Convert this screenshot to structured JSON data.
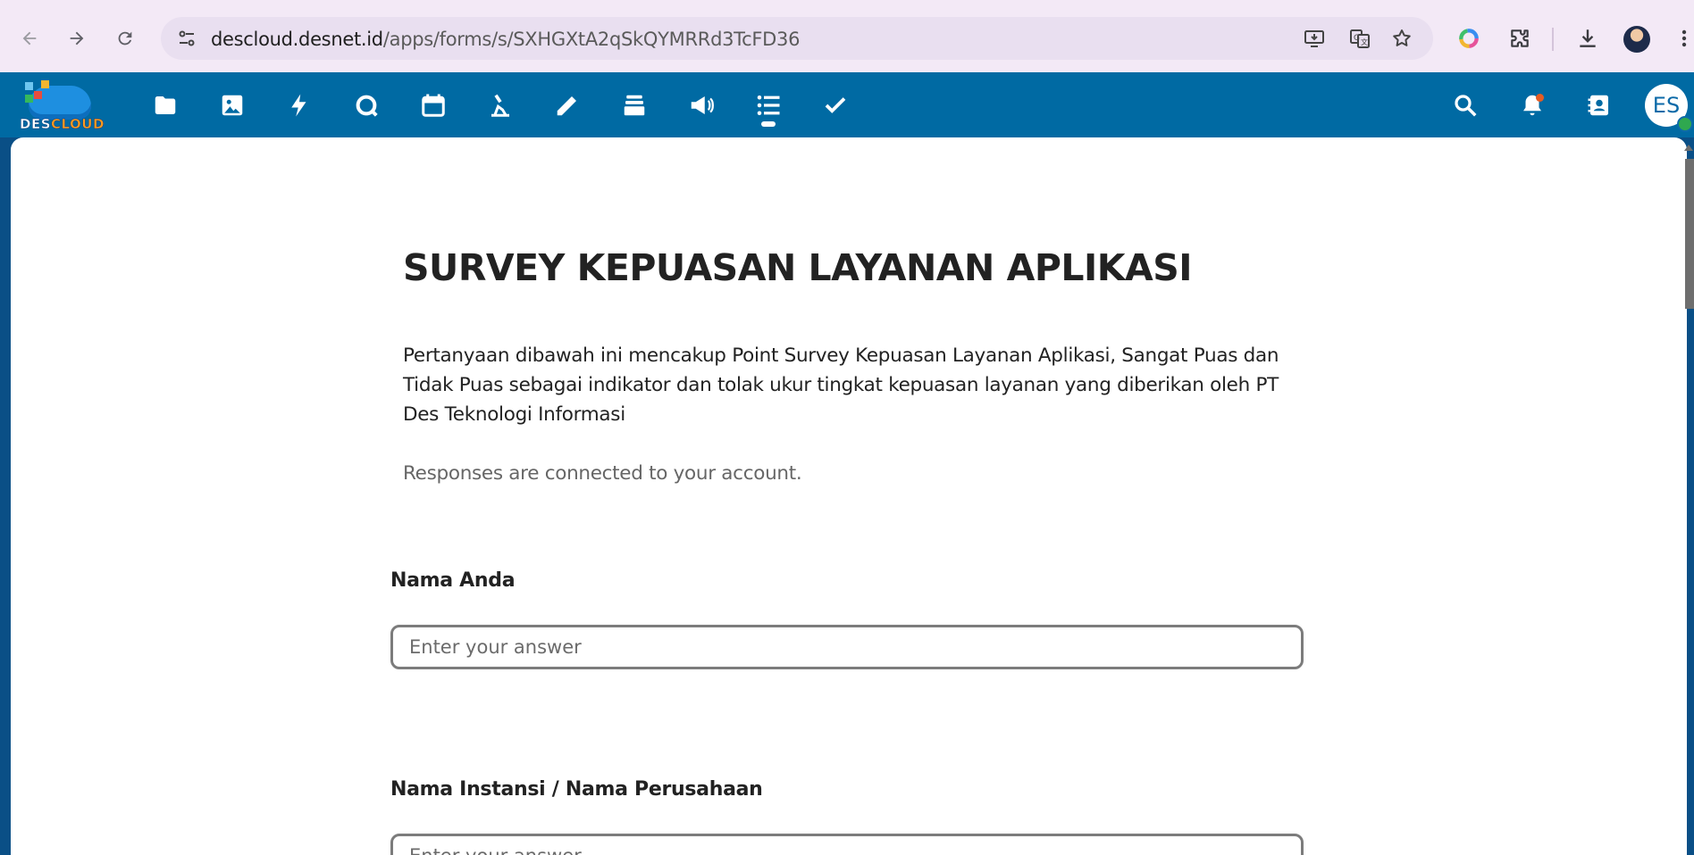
{
  "browser": {
    "url_domain": "descloud.desnet.id",
    "url_path": "/apps/forms/s/SXHGXtA2qSkQYMRRd3TcFD36",
    "icons": [
      "back-icon",
      "forward-icon",
      "reload-icon",
      "site-info-icon",
      "install-app-icon",
      "translate-icon",
      "bookmark-star-icon",
      "color-extension-icon",
      "extensions-icon",
      "download-icon",
      "profile-avatar",
      "more-menu-icon"
    ]
  },
  "app": {
    "logo_text_part1": "DES",
    "logo_text_part2": "CLOUD",
    "nav_icons": [
      "files-icon",
      "photos-icon",
      "activity-icon",
      "talk-icon",
      "calendar-icon",
      "deck-icon",
      "notes-icon",
      "stack-icon",
      "announcements-icon",
      "forms-icon",
      "tasks-icon"
    ],
    "active_app": "forms-icon",
    "right_icons": [
      "search-icon",
      "notifications-icon",
      "contacts-icon"
    ],
    "user_initials": "ES",
    "colors": {
      "header": "#006aa3",
      "notification_dot": "#e65c23",
      "status_online": "#2fa84f"
    }
  },
  "form": {
    "title": "SURVEY KEPUASAN LAYANAN APLIKASI",
    "description": "Pertanyaan dibawah ini mencakup Point Survey Kepuasan Layanan Aplikasi, Sangat Puas dan Tidak Puas sebagai indikator dan tolak ukur tingkat kepuasan layanan yang diberikan oleh PT Des Teknologi Informasi",
    "response_note": "Responses are connected to your account.",
    "questions": [
      {
        "label": "Nama Anda",
        "placeholder": "Enter your answer",
        "value": ""
      },
      {
        "label": "Nama Instansi / Nama Perusahaan",
        "placeholder": "Enter your answer",
        "value": ""
      }
    ]
  }
}
